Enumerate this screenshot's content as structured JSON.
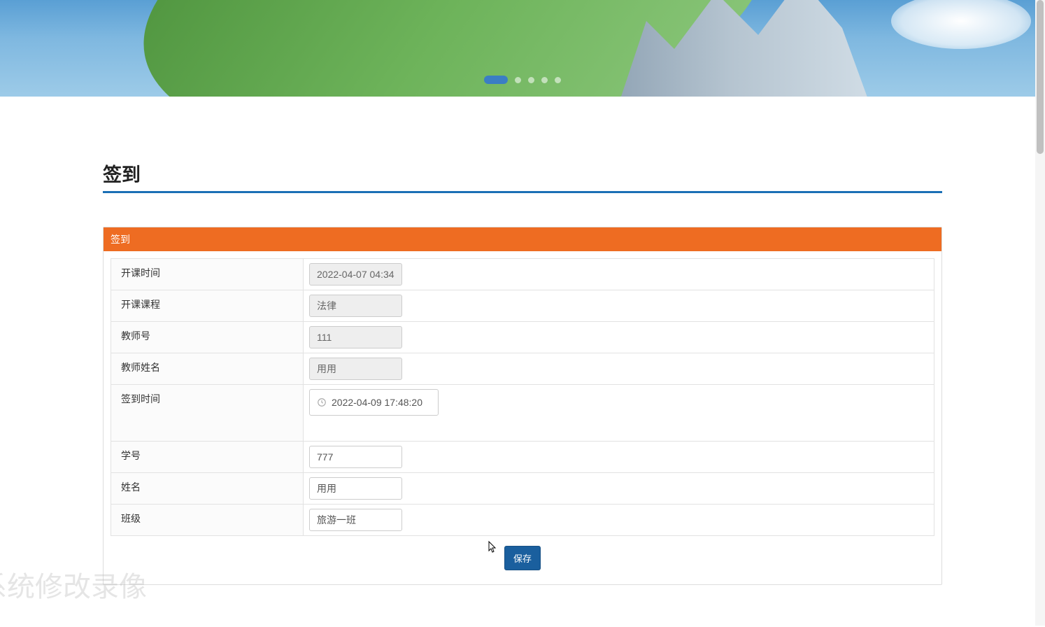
{
  "page": {
    "title": "签到",
    "watermark": "系统修改录像"
  },
  "panel": {
    "header": "签到"
  },
  "form": {
    "start_time": {
      "label": "开课时间",
      "value": "2022-04-07 04:34:01"
    },
    "course": {
      "label": "开课课程",
      "value": "法律"
    },
    "teacher_no": {
      "label": "教师号",
      "value": "111"
    },
    "teacher_nm": {
      "label": "教师姓名",
      "value": "用用"
    },
    "sign_time": {
      "label": "签到时间",
      "value": "2022-04-09 17:48:20"
    },
    "student_no": {
      "label": "学号",
      "value": "777"
    },
    "student_nm": {
      "label": "姓名",
      "value": "用用"
    },
    "class": {
      "label": "班级",
      "value": "旅游一班"
    }
  },
  "actions": {
    "save": "保存"
  }
}
